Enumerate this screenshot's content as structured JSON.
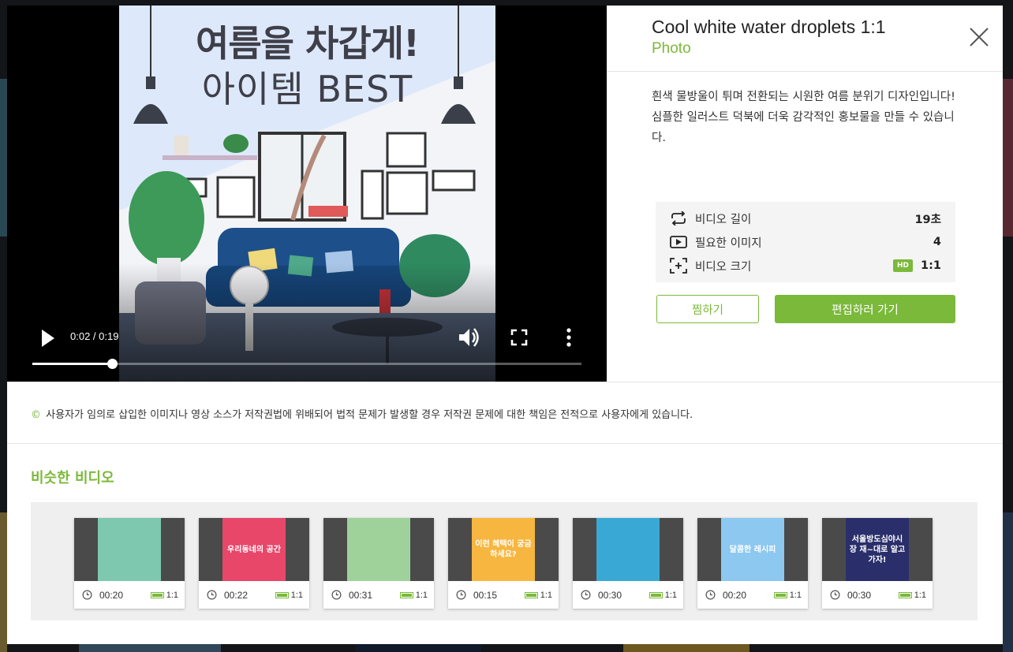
{
  "video": {
    "poster_title": "여름을 차갑게!",
    "poster_subtitle": "아이템 BEST",
    "time_display": "0:02 / 0:19",
    "progress": 0.145
  },
  "info": {
    "title": "Cool white water droplets 1:1",
    "type": "Photo",
    "description": "흰색 물방울이 튀며 전환되는 시원한 여름 분위기 디자인입니다! 심플한 일러스트 덕북에 더욱 감각적인 홍보물을 만들 수 있습니다.",
    "specs": {
      "length_label": "비디오 길이",
      "length_value": "19초",
      "images_label": "필요한 이미지",
      "images_value": "4",
      "size_label": "비디오 크기",
      "size_badge": "HD",
      "size_value": "1:1"
    },
    "like_label": "찜하기",
    "edit_label": "편집하러 가기"
  },
  "notice": {
    "symbol": "©",
    "text": "사용자가 임의로 삽입한 이미지나 영상 소스가 저작권법에 위배되어 법적 문제가 발생할 경우 저작권 문제에 대한 책임은 전적으로 사용자에게 있습니다."
  },
  "similar": {
    "title": "비슷한 비디오",
    "items": [
      {
        "duration": "00:20",
        "ratio": "1:1",
        "thumb_color": "#7fc8b0",
        "thumb_text": ""
      },
      {
        "duration": "00:22",
        "ratio": "1:1",
        "thumb_color": "#e8476a",
        "thumb_text": "우리동네의 공간"
      },
      {
        "duration": "00:31",
        "ratio": "1:1",
        "thumb_color": "#9fd29a",
        "thumb_text": ""
      },
      {
        "duration": "00:15",
        "ratio": "1:1",
        "thumb_color": "#f7b640",
        "thumb_text": "이런 혜택이 궁금하세요?"
      },
      {
        "duration": "00:30",
        "ratio": "1:1",
        "thumb_color": "#3aa8d4",
        "thumb_text": ""
      },
      {
        "duration": "00:20",
        "ratio": "1:1",
        "thumb_color": "#8cc8f0",
        "thumb_text": "달콤한 레시피"
      },
      {
        "duration": "00:30",
        "ratio": "1:1",
        "thumb_color": "#2a2f6b",
        "thumb_text": "서울방도심야시장 재~대로 알고가자!"
      }
    ]
  },
  "colors": {
    "accent": "#7bb93a"
  }
}
